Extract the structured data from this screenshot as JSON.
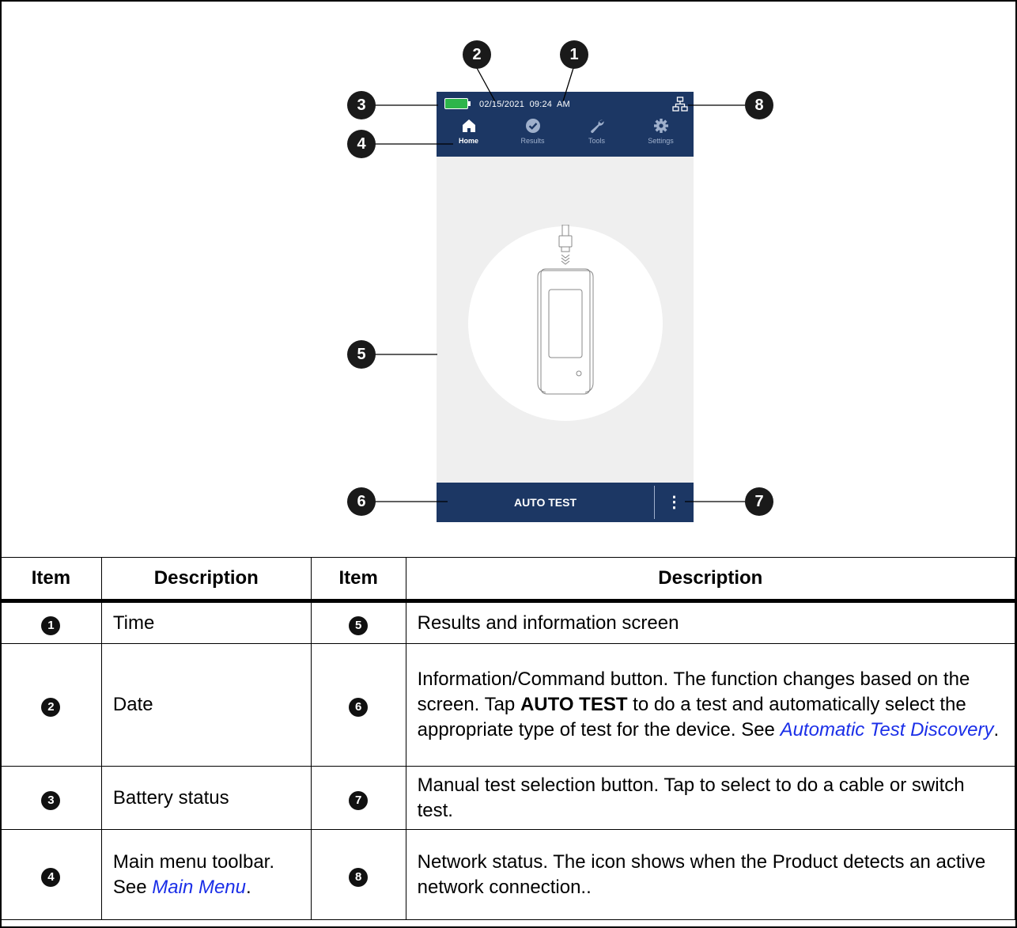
{
  "device": {
    "date": "02/15/2021",
    "time": "09:24  AM",
    "nav": [
      {
        "label": "Home",
        "icon": "home-icon"
      },
      {
        "label": "Results",
        "icon": "check-circle-icon"
      },
      {
        "label": "Tools",
        "icon": "wrench-icon"
      },
      {
        "label": "Settings",
        "icon": "gear-icon"
      }
    ],
    "command_button": "AUTO TEST",
    "more_button": "⋮",
    "colors": {
      "bar": "#1c3764",
      "battery": "#2db54a",
      "screen": "#efefef"
    }
  },
  "callouts": [
    "1",
    "2",
    "3",
    "4",
    "5",
    "6",
    "7",
    "8"
  ],
  "table": {
    "headers": [
      "Item",
      "Description",
      "Item",
      "Description"
    ],
    "rows": [
      {
        "left_num": "1",
        "left_desc": "Time",
        "right_num": "5",
        "right_desc": "Results and information screen"
      },
      {
        "left_num": "2",
        "left_desc": "Date",
        "right_num": "6",
        "right_desc_parts": [
          "Information/Command button. The function changes based on the screen. Tap ",
          "AUTO TEST",
          " to do a test and automatically select the appropriate type of test for the device. See ",
          "Automatic Test Discovery",
          "."
        ]
      },
      {
        "left_num": "3",
        "left_desc": "Battery status",
        "right_num": "7",
        "right_desc": "Manual test selection button. Tap to select to do a cable or switch test."
      },
      {
        "left_num": "4",
        "left_desc_parts": [
          "Main menu toolbar. See ",
          "Main Menu",
          "."
        ],
        "right_num": "8",
        "right_desc": "Network status. The icon shows when the Product detects an active network connection.."
      }
    ]
  }
}
